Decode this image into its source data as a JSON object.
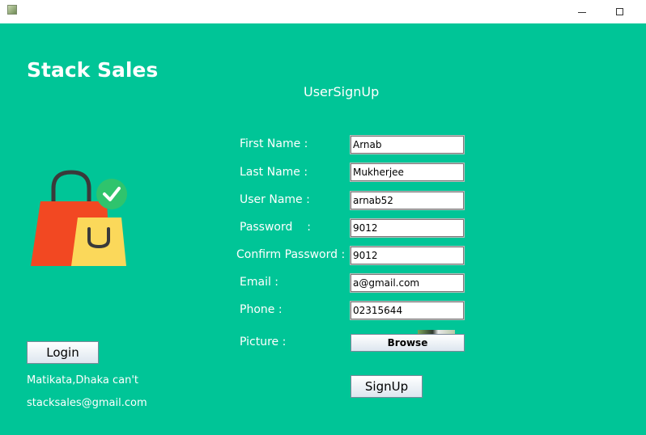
{
  "window": {
    "minimize_glyph": "—",
    "maximize_glyph": "☐"
  },
  "brand": {
    "title": "Stack Sales"
  },
  "form": {
    "title": "UserSignUp",
    "fields": [
      {
        "label": "First Name :",
        "value": "Arnab"
      },
      {
        "label": "Last Name :",
        "value": "Mukherjee"
      },
      {
        "label": "User Name :",
        "value": "arnab52"
      },
      {
        "label": "Password    :",
        "value": "9012"
      },
      {
        "label": "Confirm Password :",
        "value": "9012"
      },
      {
        "label": "Email :",
        "value": "a@gmail.com"
      },
      {
        "label": "Phone :",
        "value": "02315644"
      }
    ],
    "picture_label": "Picture :",
    "browse_label": "Browse",
    "signup_label": "SignUp"
  },
  "sidebar": {
    "login_label": "Login",
    "address": "Matikata,Dhaka can't",
    "email": "stacksales@gmail.com"
  },
  "icons": {
    "app": "app-icon",
    "shopping_bags": "shopping-bags-icon",
    "check": "check-badge-icon"
  },
  "colors": {
    "background": "#00c597",
    "bag_red": "#f24822",
    "bag_yellow": "#fbd85a",
    "check_green": "#2fc46d"
  }
}
